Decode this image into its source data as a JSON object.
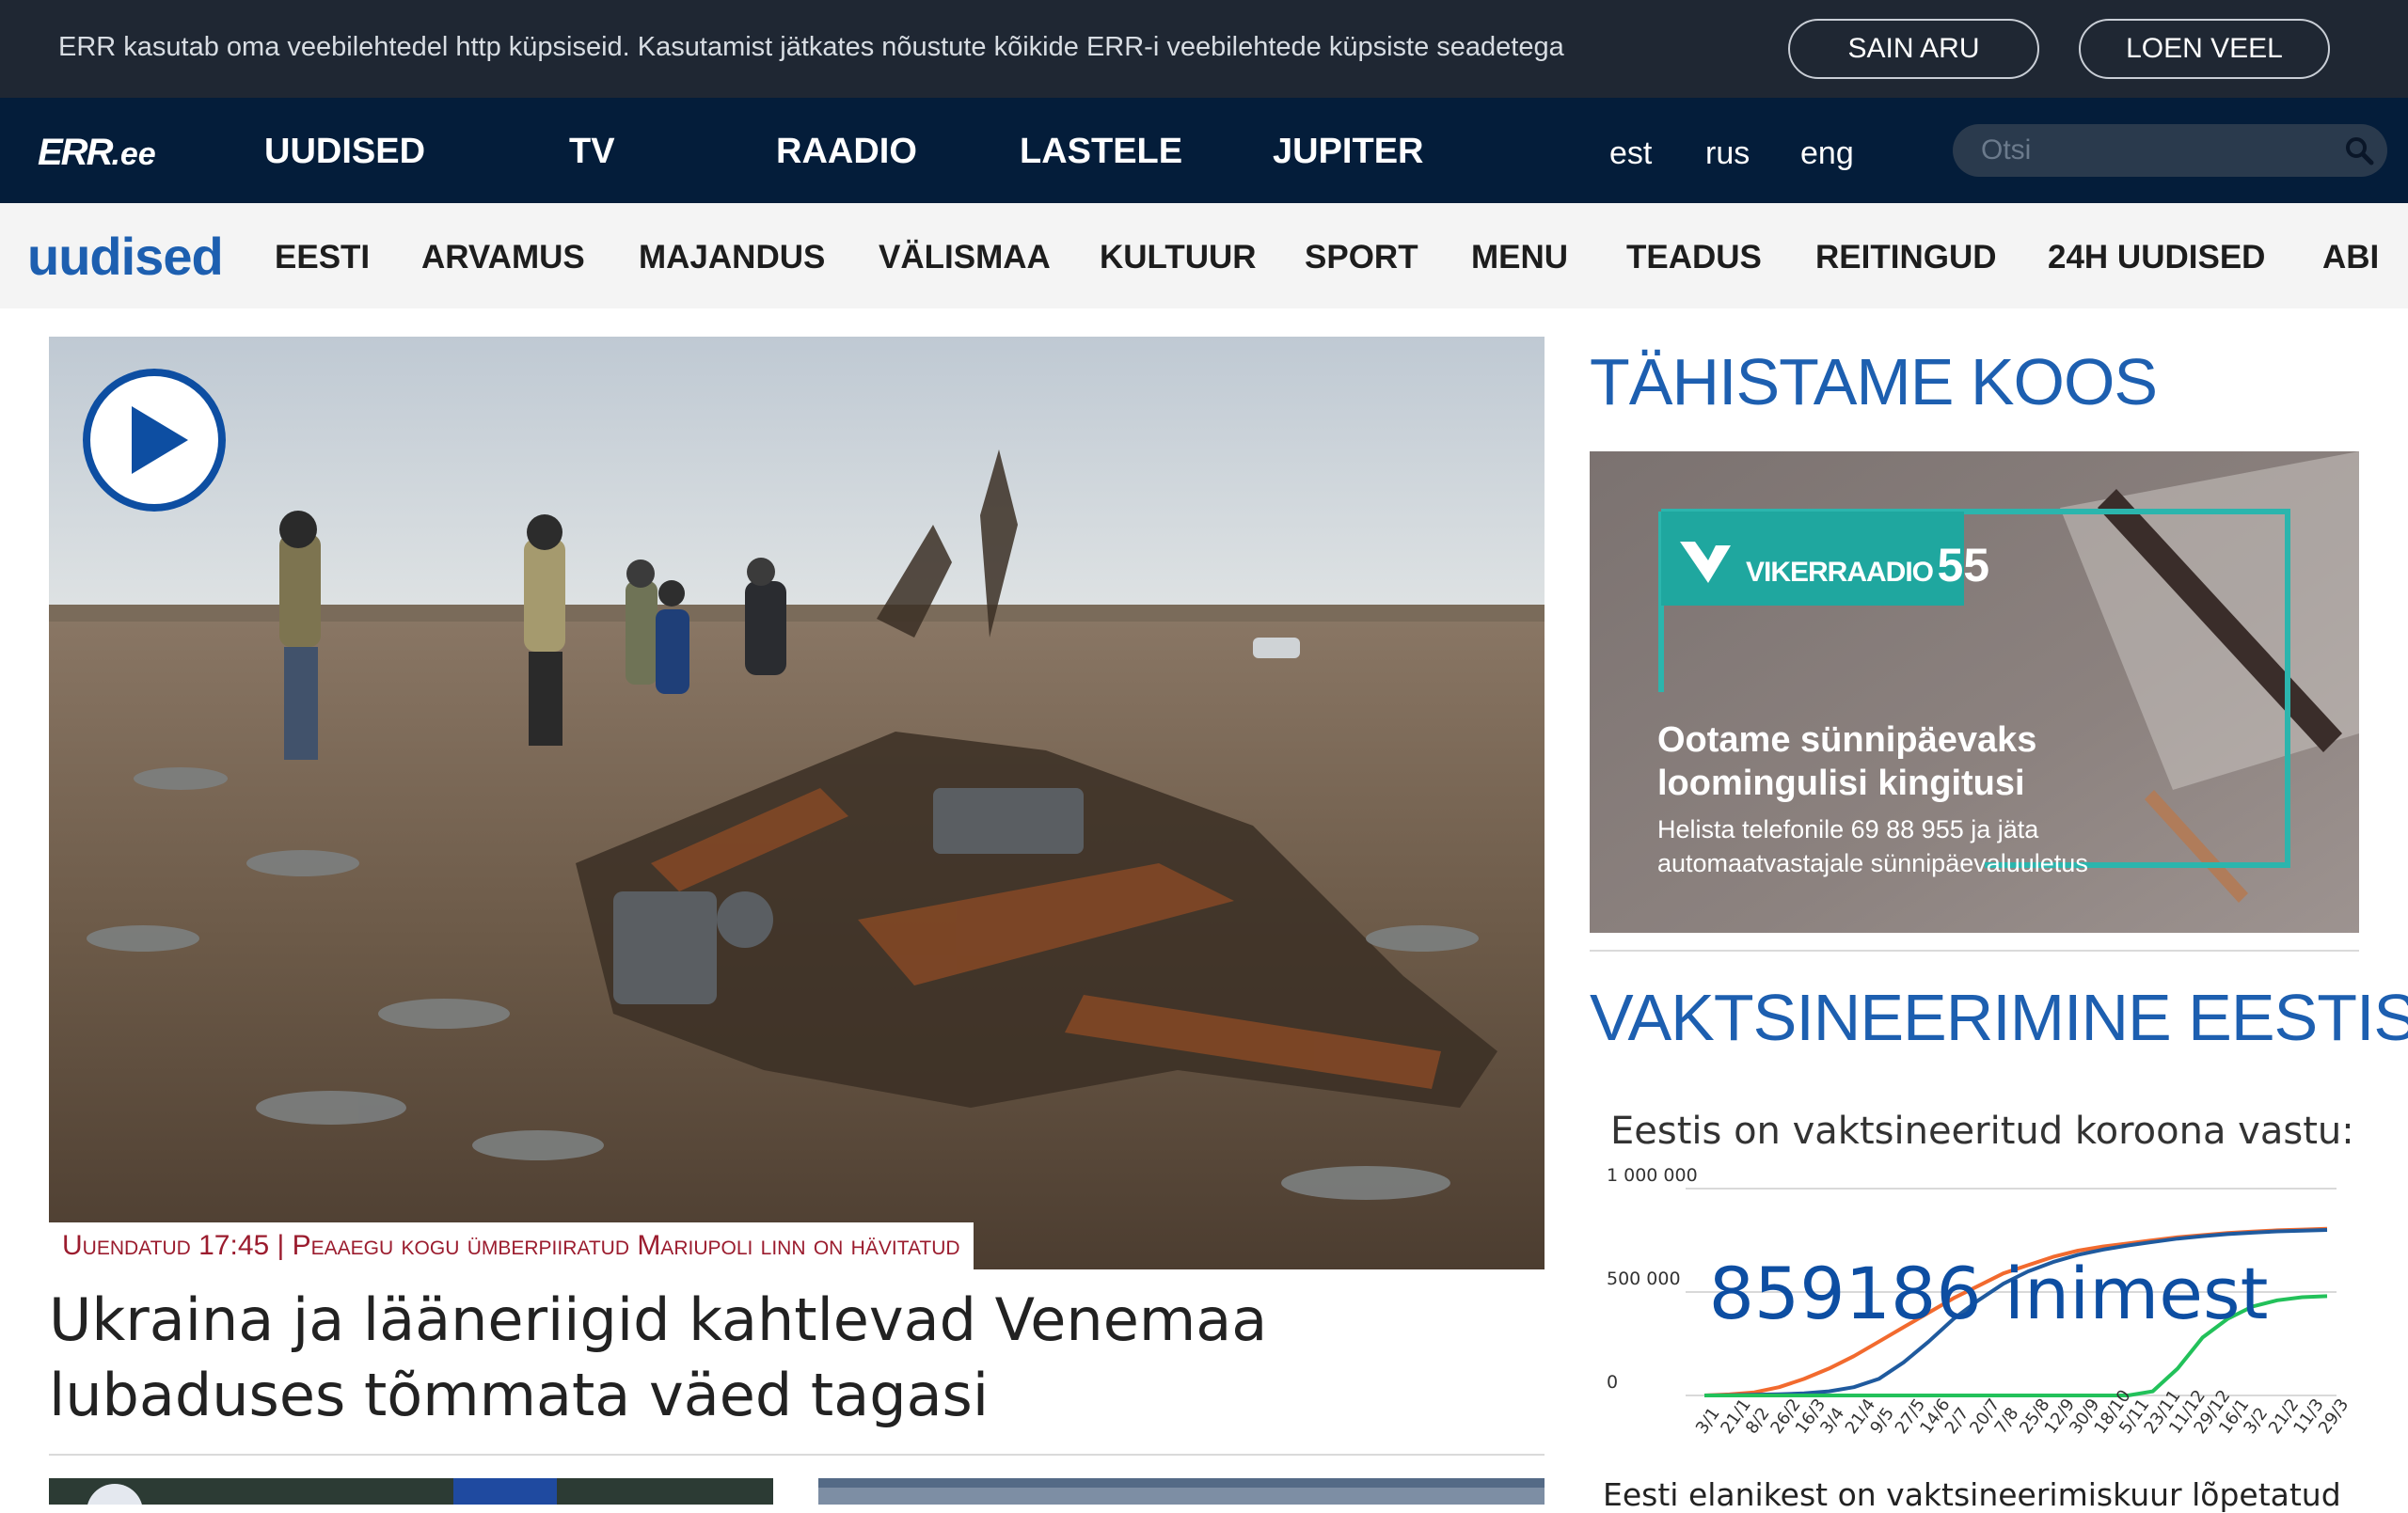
{
  "cookie": {
    "text": "ERR kasutab oma veebilehtedel http küpsiseid. Kasutamist jätkates nõustute kõikide ERR-i veebilehtede küpsiste seadetega",
    "accept_label": "SAIN ARU",
    "more_label": "LOEN VEEL"
  },
  "topnav": {
    "logo_main": "ERR",
    "logo_suffix": ".ee",
    "items": [
      "UUDISED",
      "TV",
      "RAADIO",
      "LASTELE",
      "JUPITER"
    ],
    "langs": [
      "est",
      "rus",
      "eng"
    ],
    "search_placeholder": "Otsi"
  },
  "subnav": {
    "section_logo": "uudised",
    "items": [
      "EESTI",
      "ARVAMUS",
      "MAJANDUS",
      "VÄLISMAA",
      "KULTUUR",
      "SPORT",
      "MENU",
      "TEADUS",
      "REITINGUD",
      "24H UUDISED",
      "ABI"
    ]
  },
  "hero": {
    "caption": "Uuendatud 17:45 | Peaaegu kogu ümberpiiratud Mariupoli linn on hävitatud",
    "headline": "Ukraina ja lääneriigid kahtlevad Venemaa lubaduses tõmmata väed tagasi"
  },
  "sidebar": {
    "promo_title": "TÄHISTAME KOOS",
    "promo": {
      "brand": "VIKERRAADIO",
      "brand_number": "55",
      "heading_line1": "Ootame sünnipäevaks",
      "heading_line2": "loomingulisi kingitusi",
      "body_line1": "Helista telefonile 69 88 955 ja jäta",
      "body_line2": "automaatvastajale sünnipäevaluuletus"
    },
    "vax_title": "VAKTSINEERIMINE EESTIS",
    "vax_subtitle": "Eestis on vaktsineeritud koroona vastu:",
    "vax_count": "859186 inimest",
    "vax_footer": "Eesti elanikest on vaktsineerimiskuur lõpetatud"
  },
  "chart_data": {
    "type": "line",
    "title": "",
    "ylim": [
      0,
      1000000
    ],
    "y_tick_labels": [
      "1 000 000",
      "500 000",
      "0"
    ],
    "x_tick_labels": [
      "3/1",
      "21/1",
      "8/2",
      "26/2",
      "16/3",
      "3/4",
      "21/4",
      "9/5",
      "27/5",
      "14/6",
      "2/7",
      "20/7",
      "7/8",
      "25/8",
      "12/9",
      "30/9",
      "18/10",
      "5/11",
      "23/11",
      "11/12",
      "29/12",
      "16/1",
      "3/2",
      "21/2",
      "11/3",
      "29/3"
    ],
    "series": [
      {
        "color": "#f26a2e",
        "values": [
          0,
          5000,
          15000,
          40000,
          80000,
          130000,
          190000,
          260000,
          330000,
          400000,
          470000,
          530000,
          590000,
          630000,
          670000,
          700000,
          720000,
          735000,
          750000,
          765000,
          775000,
          785000,
          792000,
          798000,
          802000,
          806000
        ]
      },
      {
        "color": "#1f5a9e",
        "values": [
          0,
          1000,
          3000,
          6000,
          10000,
          20000,
          40000,
          80000,
          160000,
          260000,
          370000,
          460000,
          540000,
          600000,
          645000,
          680000,
          705000,
          725000,
          742000,
          758000,
          770000,
          780000,
          787000,
          793000,
          797000,
          800000
        ]
      },
      {
        "color": "#22c15a",
        "values": [
          0,
          0,
          0,
          0,
          0,
          0,
          0,
          0,
          0,
          0,
          0,
          0,
          0,
          0,
          0,
          0,
          0,
          0,
          20000,
          130000,
          280000,
          370000,
          430000,
          460000,
          475000,
          480000
        ]
      }
    ]
  }
}
